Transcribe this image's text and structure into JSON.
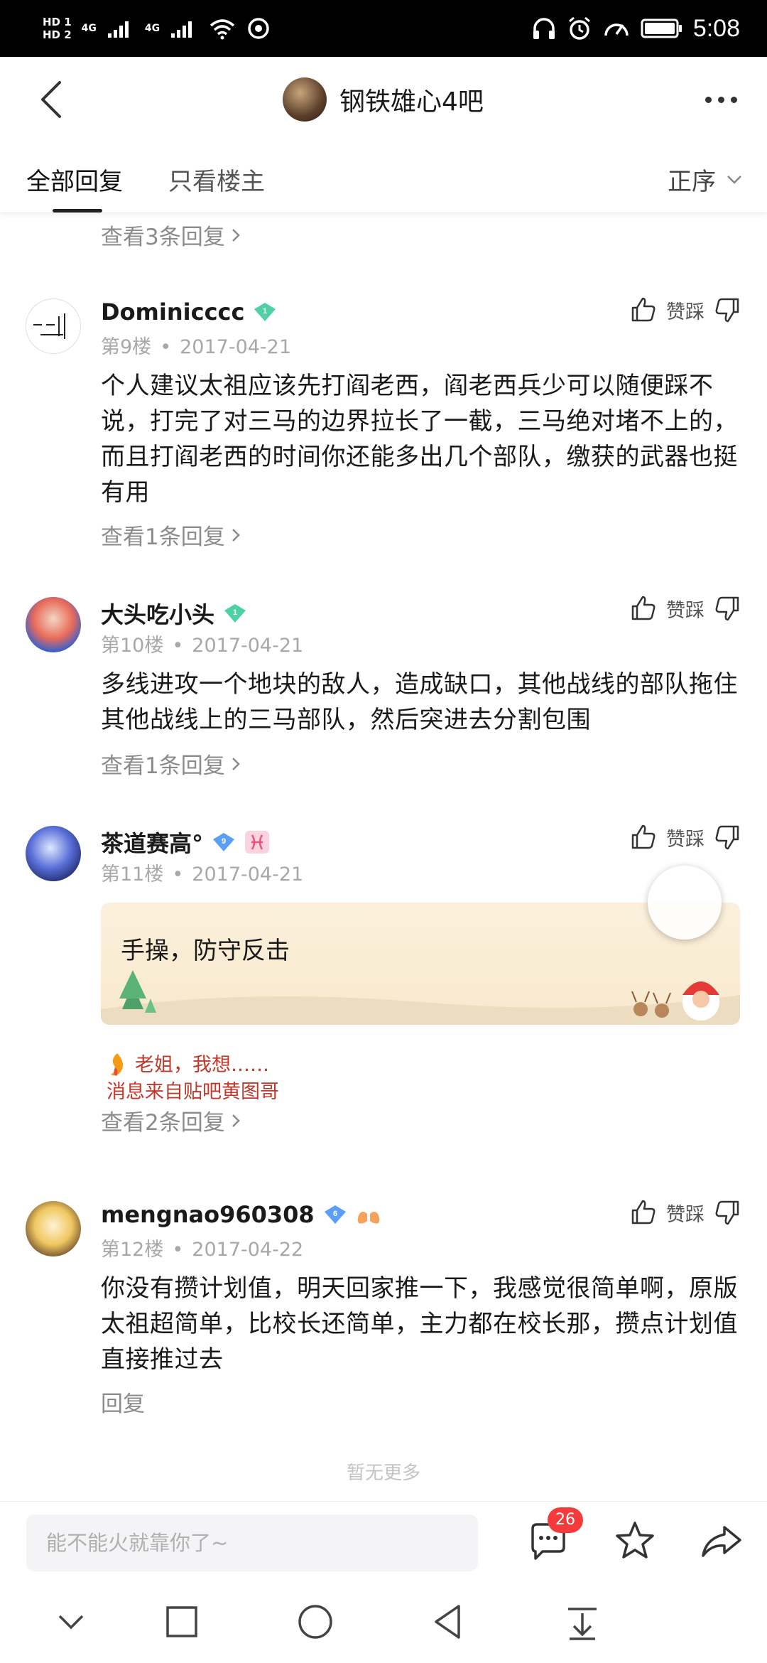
{
  "status_bar": {
    "left_labels": [
      "HD 1",
      "HD 2",
      "4G",
      "4G"
    ],
    "time": "5:08"
  },
  "header": {
    "forum_title": "钢铁雄心4吧",
    "back_icon": "chevron-left-icon",
    "more_icon": "more-dots-icon"
  },
  "tabs": {
    "all_replies": "全部回复",
    "op_only": "只看楼主",
    "sort_label": "正序"
  },
  "top_view_replies": "查看3条回复",
  "posts": [
    {
      "username": "Dominicccc",
      "level": "1",
      "floor": "第9楼",
      "date": "2017-04-21",
      "content": "个人建议太祖应该先打阎老西，阎老西兵少可以随便踩不说，打完了对三马的边界拉长了一截，三马绝对堵不上的，而且打阎老西的时间你还能多出几个部队，缴获的武器也挺有用",
      "view_replies": "查看1条回复",
      "like_label": "赞踩"
    },
    {
      "username": "大头吃小头",
      "level": "1",
      "floor": "第10楼",
      "date": "2017-04-21",
      "content": "多线进攻一个地块的敌人，造成缺口，其他战线的部队拖住其他战线上的三马部队，然后突进去分割包围",
      "view_replies": "查看1条回复",
      "like_label": "赞踩"
    },
    {
      "username": "茶道赛高°",
      "level": "9",
      "floor": "第11楼",
      "date": "2017-04-21",
      "content": "手操，防守反击",
      "tail_line1": "老姐，我想……",
      "tail_line2": "消息来自贴吧黄图哥",
      "view_replies": "查看2条回复",
      "like_label": "赞踩"
    },
    {
      "username": "mengnao960308",
      "level": "6",
      "floor": "第12楼",
      "date": "2017-04-22",
      "content": "你没有攒计划值，明天回家推一下，我感觉很简单啊，原版太祖超简单，比校长还简单，主力都在校长那，攒点计划值直接推过去",
      "reply_label": "回复",
      "like_label": "赞踩"
    }
  ],
  "no_more": "暂无更多",
  "reply_bar": {
    "placeholder": "能不能火就靠你了~",
    "comment_count": "26"
  },
  "colors": {
    "level_green": "#4fd1a5",
    "level_blue": "#5b9ef5",
    "tail_red": "#c0392b",
    "badge_red": "#f43a3a"
  }
}
